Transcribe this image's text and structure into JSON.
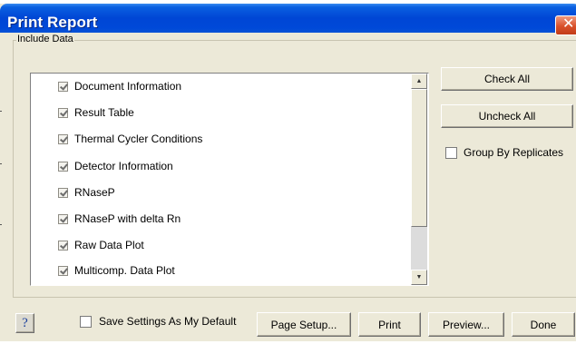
{
  "window": {
    "title": "Print Report",
    "close_glyph": "✕"
  },
  "include_data": {
    "legend": "Include Data",
    "items": [
      {
        "label": "Document Information",
        "checked": true
      },
      {
        "label": "Result Table",
        "checked": true
      },
      {
        "label": "Thermal Cycler Conditions",
        "checked": true
      },
      {
        "label": "Detector Information",
        "checked": true
      },
      {
        "label": "RNaseP",
        "checked": true
      },
      {
        "label": "RNaseP with delta Rn",
        "checked": true
      },
      {
        "label": "Raw Data Plot",
        "checked": true
      },
      {
        "label": "Multicomp. Data Plot",
        "checked": true
      }
    ],
    "scroll_up_glyph": "▲",
    "scroll_down_glyph": "▼"
  },
  "side": {
    "check_all": "Check All",
    "uncheck_all": "Uncheck All",
    "group_by_replicates": "Group By Replicates",
    "group_by_replicates_checked": false
  },
  "footer": {
    "help": "?",
    "save_default": "Save Settings As My Default",
    "save_default_checked": false,
    "page_setup": "Page Setup...",
    "print": "Print",
    "preview": "Preview...",
    "done": "Done"
  },
  "colors": {
    "titlebar": "#0046d5",
    "dialog_bg": "#ece9d8",
    "close_button": "#d8502a"
  },
  "icons": {
    "close": "close-icon",
    "help": "help-icon",
    "scroll_up": "arrow-up-icon",
    "scroll_down": "arrow-down-icon"
  }
}
